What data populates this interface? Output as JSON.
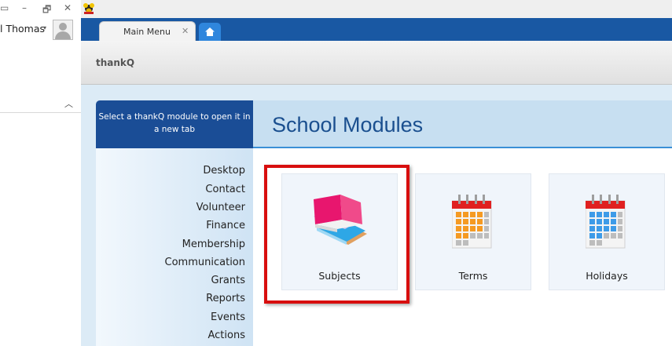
{
  "window": {
    "min_glyph": "–",
    "restore_glyph": "🗗",
    "close_glyph": "✕"
  },
  "user": {
    "name": "l Thomas",
    "caret": "▾"
  },
  "tabs": {
    "main_label": "Main Menu",
    "close_glyph": "✕"
  },
  "header": {
    "brand": "thankQ"
  },
  "sidebar": {
    "heading": "Select a thankQ module to open it in a new tab",
    "items": [
      "Desktop",
      "Contact",
      "Volunteer",
      "Finance",
      "Membership",
      "Communication",
      "Grants",
      "Reports",
      "Events",
      "Actions"
    ]
  },
  "main": {
    "title": "School Modules",
    "tiles": [
      {
        "label": "Subjects",
        "icon": "books-icon"
      },
      {
        "label": "Terms",
        "icon": "calendar-orange-icon"
      },
      {
        "label": "Holidays",
        "icon": "calendar-blue-icon"
      }
    ]
  },
  "colors": {
    "tabbar": "#1958a3",
    "highlight": "#d80e0e",
    "title": "#1a4f8f",
    "sidehead": "#1a4d96"
  }
}
